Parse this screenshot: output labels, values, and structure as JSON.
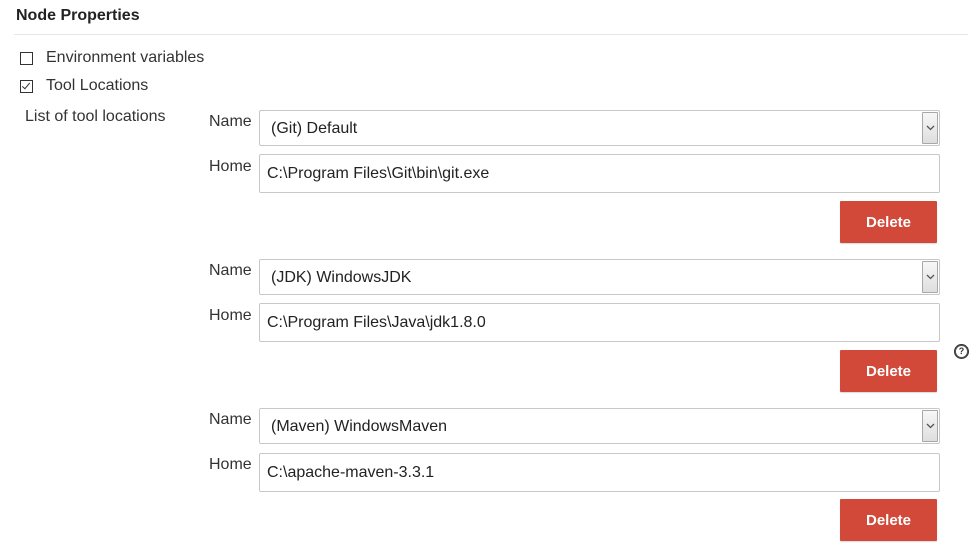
{
  "section": {
    "title": "Node Properties"
  },
  "options": [
    {
      "label": "Environment variables",
      "checked": false
    },
    {
      "label": "Tool Locations",
      "checked": true
    }
  ],
  "tool_locations": {
    "label": "List of tool locations",
    "name_label": "Name",
    "home_label": "Home",
    "delete_label": "Delete",
    "entries": [
      {
        "name": "(Git) Default",
        "home": "C:\\Program Files\\Git\\bin\\git.exe"
      },
      {
        "name": "(JDK) WindowsJDK",
        "home": "C:\\Program Files\\Java\\jdk1.8.0"
      },
      {
        "name": "(Maven) WindowsMaven",
        "home": "C:\\apache-maven-3.3.1"
      }
    ]
  },
  "help": {
    "icon": "help-icon",
    "glyph": "?"
  },
  "colors": {
    "delete_button": "#d24939",
    "text": "#333333",
    "border": "#c8c8c8"
  }
}
